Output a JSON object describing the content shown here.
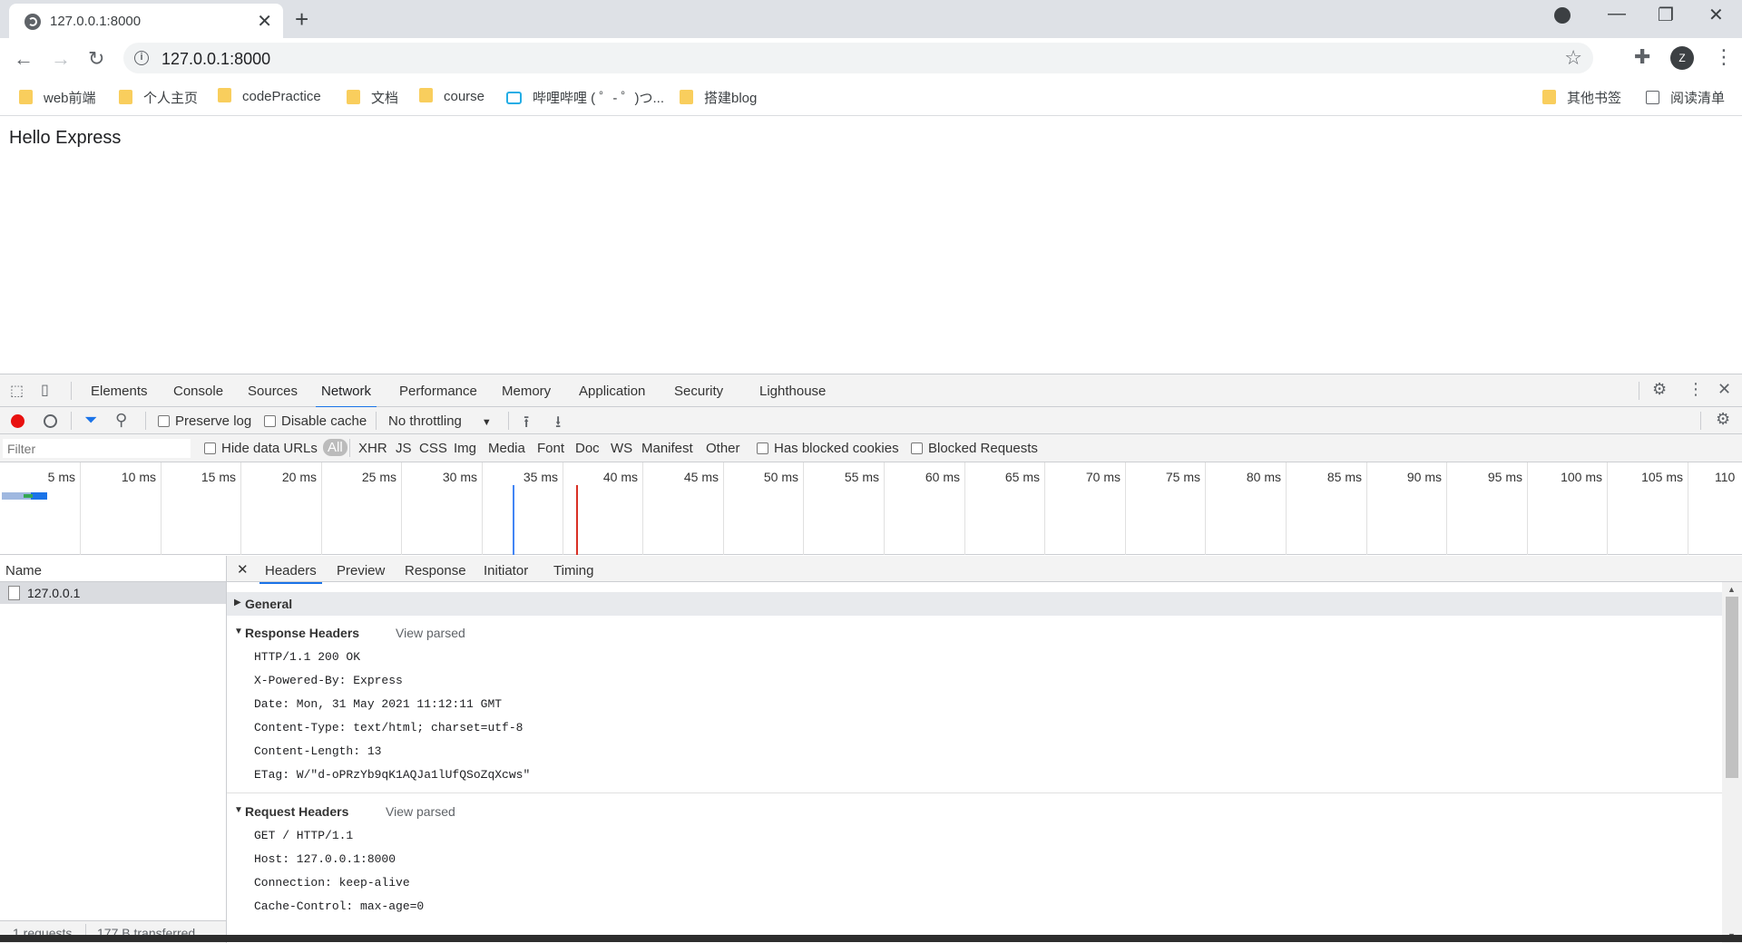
{
  "browser": {
    "tab_title": "127.0.0.1:8000",
    "url": "127.0.0.1:8000",
    "profile_initial": "Z"
  },
  "bookmarks": [
    {
      "label": "web前端",
      "icon": "folder-icon"
    },
    {
      "label": "个人主页",
      "icon": "folder-icon"
    },
    {
      "label": "codePractice",
      "icon": "folder-icon"
    },
    {
      "label": "文档",
      "icon": "folder-icon"
    },
    {
      "label": "course",
      "icon": "folder-icon"
    },
    {
      "label": "哔哩哔哩 ( ゜- ゜)つ...",
      "icon": "bilibili-icon"
    },
    {
      "label": "搭建blog",
      "icon": "folder-icon"
    },
    {
      "label": "其他书签",
      "icon": "folder-icon"
    },
    {
      "label": "阅读清单",
      "icon": "reading-list-icon"
    }
  ],
  "page": {
    "heading": "Hello Express"
  },
  "devtools": {
    "tabs": [
      "Elements",
      "Console",
      "Sources",
      "Network",
      "Performance",
      "Memory",
      "Application",
      "Security",
      "Lighthouse"
    ],
    "active_tab": "Network",
    "controls": {
      "preserve_log": "Preserve log",
      "disable_cache": "Disable cache",
      "throttling": "No throttling"
    },
    "filter": {
      "placeholder": "Filter",
      "hide_data_urls": "Hide data URLs",
      "types": [
        "All",
        "XHR",
        "JS",
        "CSS",
        "Img",
        "Media",
        "Font",
        "Doc",
        "WS",
        "Manifest",
        "Other"
      ],
      "has_blocked_cookies": "Has blocked cookies",
      "blocked_requests": "Blocked Requests"
    },
    "timeline_ticks": [
      "5 ms",
      "10 ms",
      "15 ms",
      "20 ms",
      "25 ms",
      "30 ms",
      "35 ms",
      "40 ms",
      "45 ms",
      "50 ms",
      "55 ms",
      "60 ms",
      "65 ms",
      "70 ms",
      "75 ms",
      "80 ms",
      "85 ms",
      "90 ms",
      "95 ms",
      "100 ms",
      "105 ms",
      "110"
    ],
    "name_column": "Name",
    "requests": [
      "127.0.0.1"
    ],
    "status": {
      "requests": "1 requests",
      "transferred": "177 B transferred"
    },
    "detail_tabs": [
      "Headers",
      "Preview",
      "Response",
      "Initiator",
      "Timing"
    ],
    "sections": {
      "general": "General",
      "response_headers": "Response Headers",
      "request_headers": "Request Headers",
      "view_parsed": "View parsed"
    },
    "response_headers": [
      "HTTP/1.1 200 OK",
      "X-Powered-By: Express",
      "Date: Mon, 31 May 2021 11:12:11 GMT",
      "Content-Type: text/html; charset=utf-8",
      "Content-Length: 13",
      "ETag: W/\"d-oPRzYb9qK1AQJa1lUfQSoZqXcws\""
    ],
    "request_headers": [
      "GET / HTTP/1.1",
      "Host: 127.0.0.1:8000",
      "Connection: keep-alive",
      "Cache-Control: max-age=0"
    ]
  }
}
